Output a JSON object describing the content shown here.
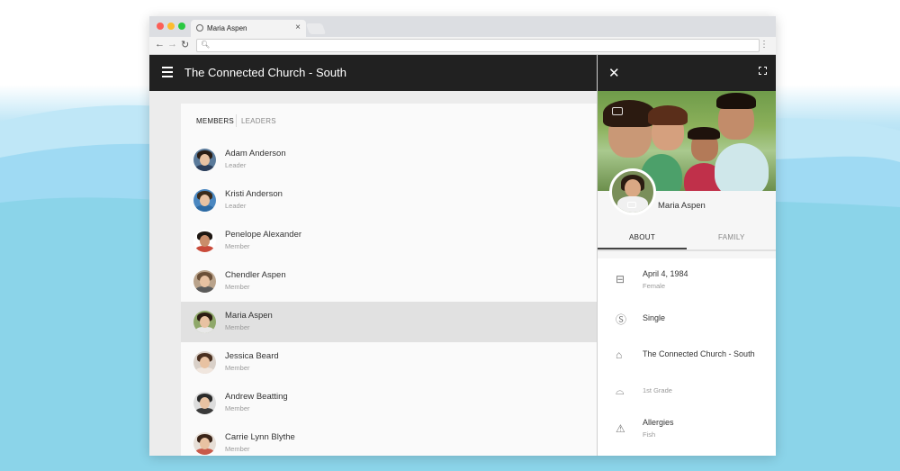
{
  "browser": {
    "tab_title": "Maria Aspen",
    "tab_close": "×",
    "back": "←",
    "forward": "→",
    "reload": "↻",
    "menu": "⋮",
    "omnibox_icon": "🔍︎"
  },
  "app": {
    "title": "The Connected Church - South",
    "tabs": [
      "MEMBERS",
      "LEADERS"
    ],
    "members": [
      {
        "name": "Adam Anderson",
        "role": "Leader"
      },
      {
        "name": "Kristi Anderson",
        "role": "Leader"
      },
      {
        "name": "Penelope Alexander",
        "role": "Member"
      },
      {
        "name": "Chendler Aspen",
        "role": "Member"
      },
      {
        "name": "Maria Aspen",
        "role": "Member"
      },
      {
        "name": "Jessica Beard",
        "role": "Member"
      },
      {
        "name": "Andrew Beatting",
        "role": "Member"
      },
      {
        "name": "Carrie Lynn Blythe",
        "role": "Member"
      }
    ],
    "selected_index": 4
  },
  "profile": {
    "close": "✕",
    "name": "Maria Aspen",
    "tabs": [
      "ABOUT",
      "FAMILY"
    ],
    "details": [
      {
        "icon": "cake-icon",
        "glyph": "⊟",
        "main": "April 4, 1984",
        "sub": "Female"
      },
      {
        "icon": "marital-status-icon",
        "glyph": "Ⓢ",
        "main": "Single",
        "sub": ""
      },
      {
        "icon": "church-icon",
        "glyph": "⌂",
        "main": "The Connected Church - South",
        "sub": ""
      },
      {
        "icon": "school-icon",
        "glyph": "⌓",
        "main": "",
        "sub": "1st Grade"
      },
      {
        "icon": "warning-icon",
        "glyph": "⚠",
        "main": "Allergies",
        "sub": "Fish"
      }
    ]
  },
  "colors": {
    "appbar": "#212121",
    "selected_row": "#e1e1e1",
    "background_teal": "#86e0c3",
    "background_blue": "#8fd3ef"
  }
}
